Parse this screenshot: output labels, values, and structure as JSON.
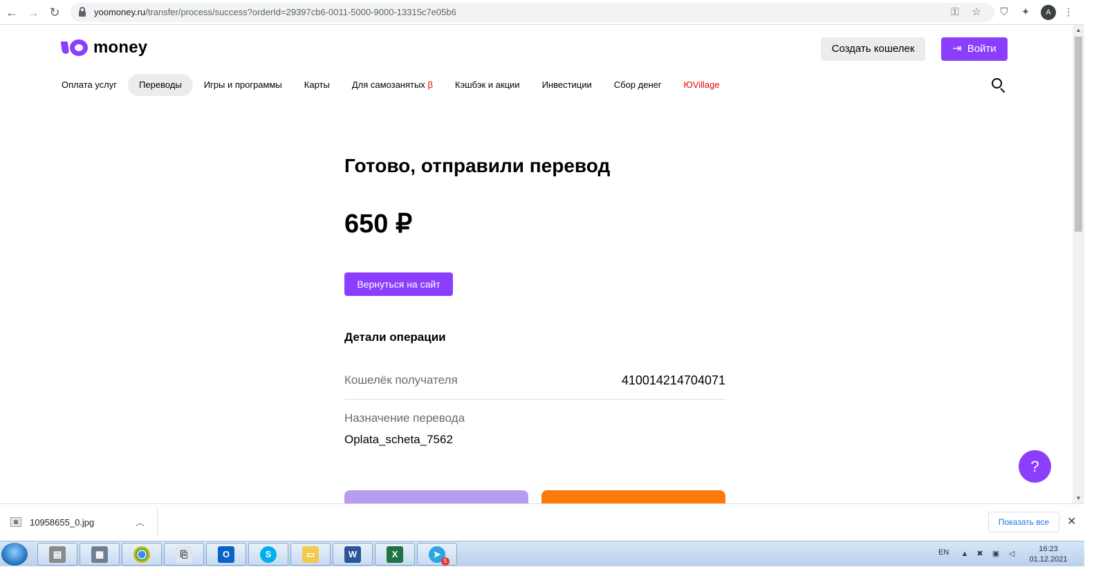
{
  "browser": {
    "url_host": "yoomoney.ru",
    "url_path": "/transfer/process/success?orderId=29397cb6-0011-5000-9000-13315c7e05b6",
    "profile_initial": "A"
  },
  "header": {
    "logo_text": "money",
    "create_wallet_label": "Создать кошелек",
    "login_label": "Войти"
  },
  "nav": {
    "items": [
      {
        "label": "Оплата услуг"
      },
      {
        "label": "Переводы"
      },
      {
        "label": "Игры и программы"
      },
      {
        "label": "Карты"
      },
      {
        "label": "Для самозанятых"
      },
      {
        "label": "Кэшбэк и акции"
      },
      {
        "label": "Инвестиции"
      },
      {
        "label": "Сбор денег"
      },
      {
        "label": "ЮVillage"
      }
    ],
    "beta_mark": "β",
    "active_index": 1
  },
  "main": {
    "title": "Готово, отправили перевод",
    "amount": "650 ₽",
    "back_button_label": "Вернуться на сайт",
    "details_heading": "Детали операции",
    "recipient_wallet_label": "Кошелёк получателя",
    "recipient_wallet_value": "4100142147040­71",
    "purpose_label": "Назначение перевода",
    "purpose_value": "Oplata_scheta_7562",
    "help_label": "?"
  },
  "downloads": {
    "file_name": "10958655_0.jpg",
    "show_all_label": "Показать все",
    "close_label": "✕"
  },
  "taskbar": {
    "language": "EN",
    "time": "16:23",
    "date": "01.12.2021",
    "telegram_badge": "5"
  },
  "colors": {
    "accent": "#8b3ffd",
    "orange": "#fa7a0a",
    "red": "#e60000"
  }
}
